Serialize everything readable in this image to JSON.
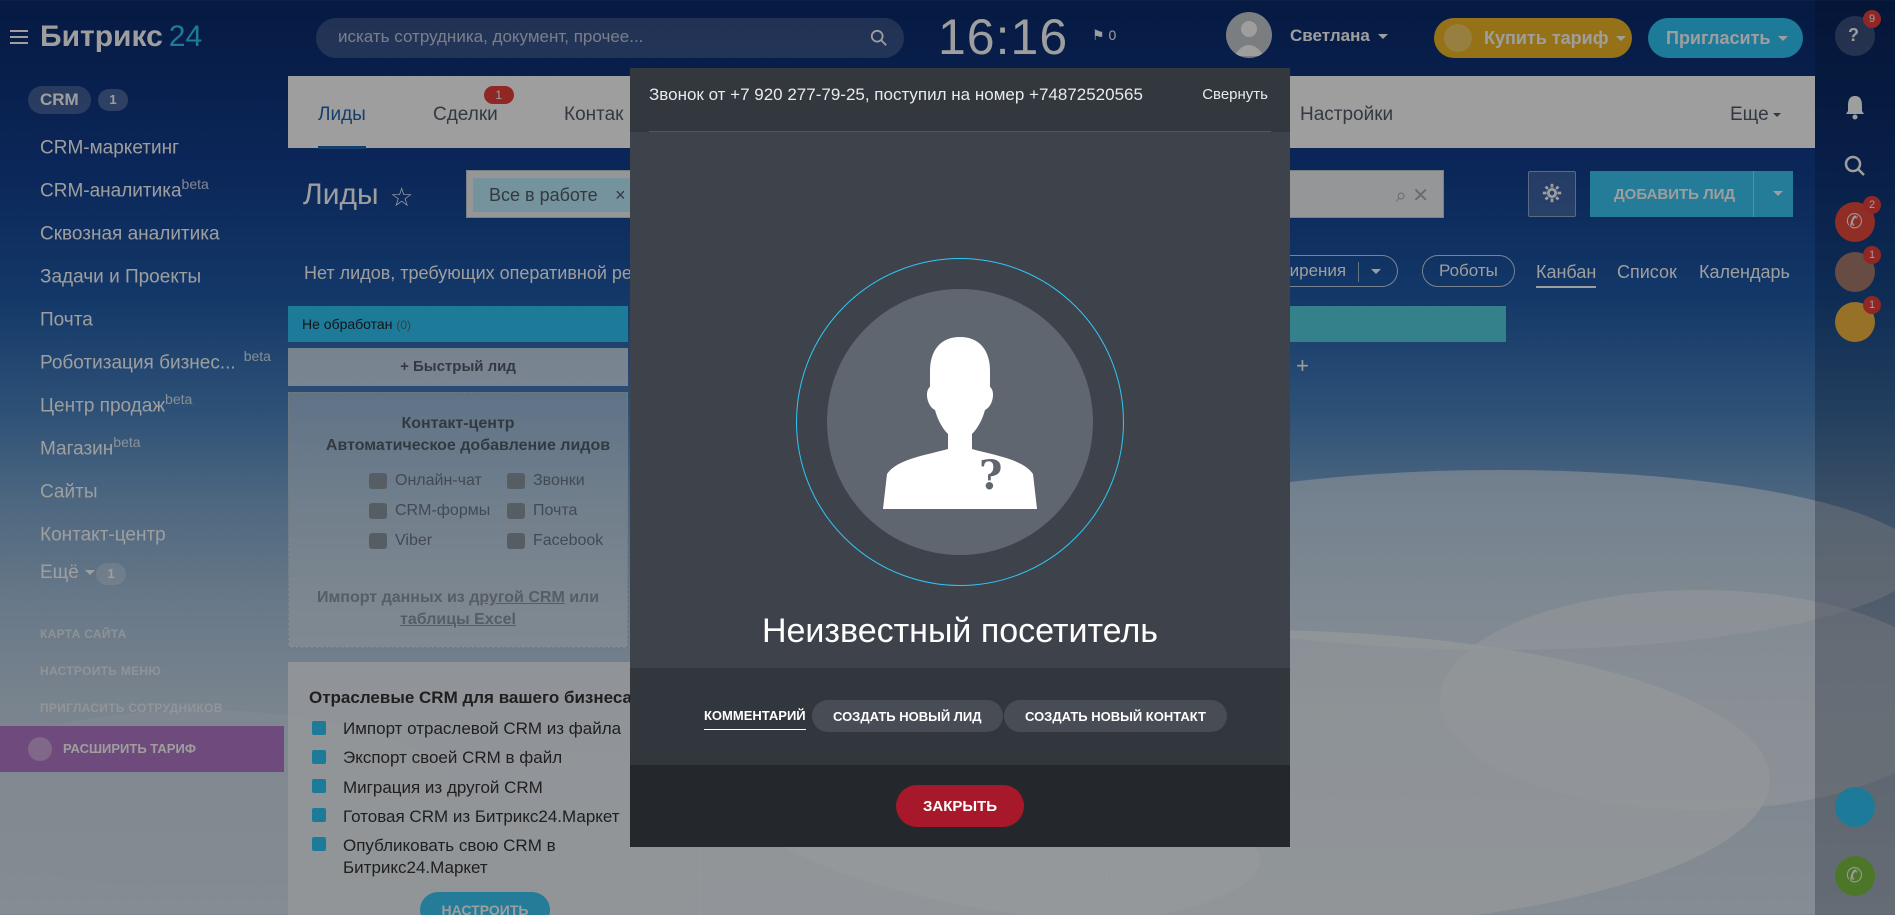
{
  "header": {
    "logo_main": "Битрикс",
    "logo_num": "24",
    "search_placeholder": "искать сотрудника, документ, прочее...",
    "clock": "16:16",
    "flag_count": "0",
    "user_name": "Светлана",
    "buy_label": "Купить тариф",
    "invite_label": "Пригласить"
  },
  "sidebar": {
    "crm_label": "CRM",
    "crm_count": "1",
    "items": [
      {
        "label": "CRM-маркетинг",
        "sup": ""
      },
      {
        "label": "CRM-аналитика",
        "sup": "beta"
      },
      {
        "label": "Сквозная аналитика",
        "sup": ""
      },
      {
        "label": "Задачи и Проекты",
        "sup": ""
      },
      {
        "label": "Почта",
        "sup": ""
      },
      {
        "label": "Роботизация бизнес...",
        "sup": "beta"
      },
      {
        "label": "Центр продаж",
        "sup": "beta"
      },
      {
        "label": "Магазин",
        "sup": "beta"
      },
      {
        "label": "Сайты",
        "sup": ""
      },
      {
        "label": "Контакт-центр",
        "sup": ""
      }
    ],
    "more_label": "Ещё",
    "more_count": "1",
    "sitemap": "КАРТА САЙТА",
    "menu_setup": "НАСТРОИТЬ МЕНЮ",
    "invite_staff": "ПРИГЛАСИТЬ СОТРУДНИКОВ",
    "expand_plan": "РАСШИРИТЬ ТАРИФ"
  },
  "tabs": {
    "leads": "Лиды",
    "deals": "Сделки",
    "deals_badge": "1",
    "contacts": "Контак",
    "settings": "Настройки",
    "more": "Еще"
  },
  "crm": {
    "title": "Лиды",
    "filter_chip": "Все в работе",
    "add_lead": "ДОБАВИТЬ ЛИД",
    "no_leads": "Нет лидов, требующих оперативной ре",
    "extensions": "ширения",
    "robots": "Роботы",
    "kanban": "Канбан",
    "list": "Список",
    "calendar": "Календарь",
    "stage_title": "Не обработан",
    "stage_count": "(0)",
    "quick_lead": "Быстрый лид",
    "cc_title": "Контакт-центр",
    "cc_sub": "Автоматическое добавление лидов",
    "channels": [
      "Онлайн-чат",
      "Звонки",
      "CRM-формы",
      "Почта",
      "Viber",
      "Facebook"
    ],
    "import_prefix": "Импорт данных из ",
    "import_link1": "другой CRM",
    "import_mid": " или",
    "import_link2": "таблицы Excel",
    "industry_title": "Отраслевые CRM для вашего бизнеса",
    "industry_items": [
      "Импорт отраслевой CRM из файла",
      "Экспорт своей CRM в файл",
      "Миграция из другой CRM",
      "Готовая CRM из Битрикс24.Маркет",
      "Опубликовать свою CRM в",
      "Битрикс24.Маркет"
    ],
    "setup_btn": "НАСТРОИТЬ"
  },
  "call": {
    "header_text": "Звонок от +7 920 277-79-25, поступил на номер +74872520565",
    "minimize": "Свернуть",
    "visitor": "Неизвестный посетитель",
    "comment": "КОММЕНТАРИЙ",
    "new_lead": "СОЗДАТЬ НОВЫЙ ЛИД",
    "new_contact": "СОЗДАТЬ НОВЫЙ КОНТАКТ",
    "close": "ЗАКРЫТЬ"
  },
  "rail": {
    "help_badge": "9",
    "phone_badge": "2",
    "user1_badge": "1",
    "user2_badge": "1"
  },
  "colors": {
    "accent": "#2fc6f6",
    "close_red": "#a7192a",
    "buy_yellow": "#f0b828",
    "badge_red": "#e8403d"
  }
}
